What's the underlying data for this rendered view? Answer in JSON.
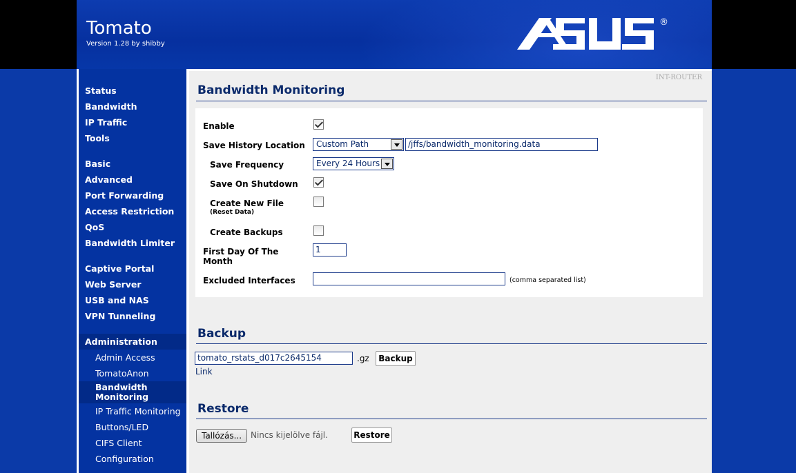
{
  "header": {
    "title": "Tomato",
    "version": "Version 1.28 by shibby",
    "logo_text": "/ISUS",
    "logo_mark": "®"
  },
  "router_name": "INT-ROUTER",
  "sidebar": {
    "group1": [
      "Status",
      "Bandwidth",
      "IP Traffic",
      "Tools"
    ],
    "group2": [
      "Basic",
      "Advanced",
      "Port Forwarding",
      "Access Restriction",
      "QoS",
      "Bandwidth Limiter"
    ],
    "group3": [
      "Captive Portal",
      "Web Server",
      "USB and NAS",
      "VPN Tunneling"
    ],
    "admin": {
      "label": "Administration",
      "items": [
        "Admin Access",
        "TomatoAnon",
        "Bandwidth Monitoring",
        "IP Traffic Monitoring",
        "Buttons/LED",
        "CIFS Client",
        "Configuration"
      ],
      "active": "Bandwidth Monitoring"
    }
  },
  "bandwidth": {
    "title": "Bandwidth Monitoring",
    "enable_label": "Enable",
    "enable_checked": true,
    "save_history_label": "Save History Location",
    "save_history_value": "Custom Path",
    "save_history_path": "/jffs/bandwidth_monitoring.data",
    "save_frequency_label": "Save Frequency",
    "save_frequency_value": "Every 24 Hours",
    "save_on_shutdown_label": "Save On Shutdown",
    "save_on_shutdown_checked": true,
    "create_new_file_label": "Create New File",
    "create_new_file_sub": "(Reset Data)",
    "create_new_file_checked": false,
    "create_backups_label": "Create Backups",
    "create_backups_checked": false,
    "first_day_label_1": "First Day Of The",
    "first_day_label_2": "Month",
    "first_day_value": "1",
    "excluded_label": "Excluded Interfaces",
    "excluded_value": "",
    "excluded_note": "(comma separated list)"
  },
  "backup": {
    "title": "Backup",
    "filename": "tomato_rstats_d017c2645154",
    "ext": ".gz",
    "button": "Backup",
    "link": "Link"
  },
  "restore": {
    "title": "Restore",
    "browse_button": "Tallózás...",
    "no_file": "Nincs kijelölve fájl.",
    "button": "Restore"
  }
}
